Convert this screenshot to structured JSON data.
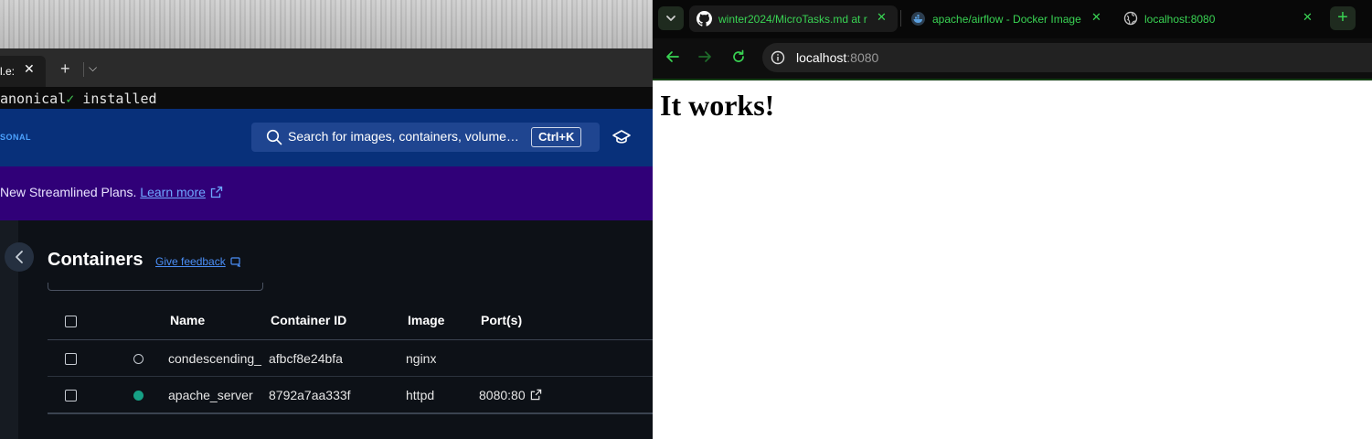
{
  "terminal": {
    "tab_title": "l.e:",
    "tab_close": "✕",
    "new_tab": "+",
    "dropdown": "⌵",
    "line": {
      "prefix": "anonical",
      "check": "✓",
      "suffix": " installed"
    }
  },
  "docker_desktop": {
    "brand": "SONAL",
    "search": {
      "placeholder": "Search for images, containers, volume…",
      "shortcut": "Ctrl+K"
    },
    "banner": {
      "text": "New Streamlined Plans.",
      "link": "Learn more"
    },
    "page_title": "Containers",
    "feedback_link": "Give feedback",
    "table": {
      "headers": {
        "name": "Name",
        "container_id": "Container ID",
        "image": "Image",
        "ports": "Port(s)"
      },
      "rows": [
        {
          "status": "stopped",
          "name": "condescending_",
          "container_id": "afbcf8e24bfa",
          "image": "nginx",
          "ports": ""
        },
        {
          "status": "running",
          "name": "apache_server",
          "container_id": "8792a7aa333f",
          "image": "httpd",
          "ports": "8080:80"
        }
      ]
    }
  },
  "browser": {
    "tabs": [
      {
        "title": "winter2024/MicroTasks.md at r",
        "icon": "github-icon",
        "active": true
      },
      {
        "title": "apache/airflow - Docker Image",
        "icon": "docker-icon",
        "active": false
      },
      {
        "title": "localhost:8080",
        "icon": "globe-icon",
        "active": false
      }
    ],
    "tab_close": "✕",
    "new_tab": "+",
    "address": {
      "host": "localhost",
      "port": ":8080"
    },
    "accent_color": "#39d353"
  },
  "page": {
    "heading": "It works!"
  }
}
